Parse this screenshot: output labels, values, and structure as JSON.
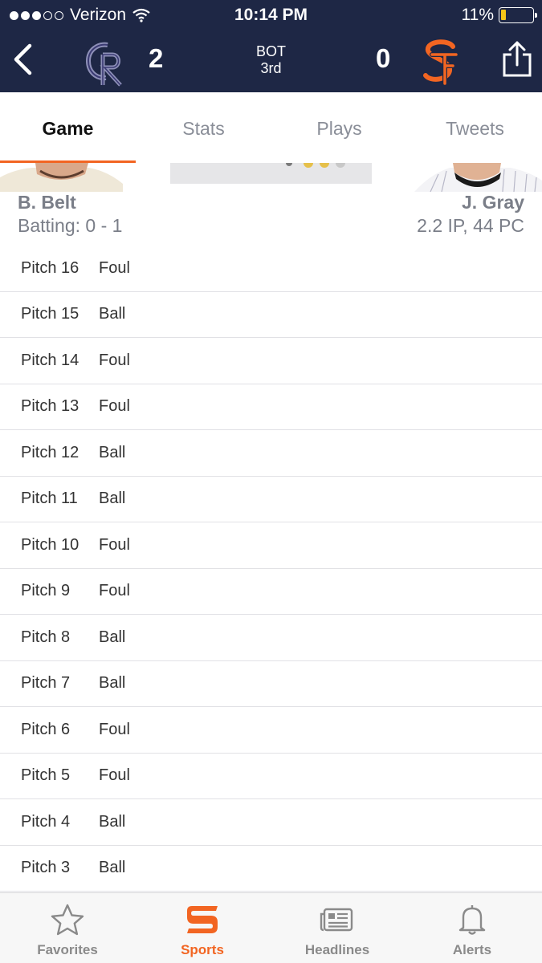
{
  "status_bar": {
    "carrier": "Verizon",
    "time": "10:14 PM",
    "battery": "11%",
    "battery_level": 0.11
  },
  "scoreboard": {
    "away_score": "2",
    "home_score": "0",
    "inning_half": "BOT",
    "inning": "3rd",
    "away_color": "#5a5a9a",
    "home_color": "#f26522"
  },
  "tabs": [
    {
      "label": "Game",
      "active": true
    },
    {
      "label": "Stats",
      "active": false
    },
    {
      "label": "Plays",
      "active": false
    },
    {
      "label": "Tweets",
      "active": false
    }
  ],
  "matchup": {
    "batter": {
      "name": "B. Belt",
      "stat": "Batting: 0 - 1"
    },
    "pitcher": {
      "name": "J. Gray",
      "stat": "2.2 IP, 44 PC"
    }
  },
  "pitches": [
    {
      "label": "Pitch 16",
      "result": "Foul"
    },
    {
      "label": "Pitch 15",
      "result": "Ball"
    },
    {
      "label": "Pitch 14",
      "result": "Foul"
    },
    {
      "label": "Pitch 13",
      "result": "Foul"
    },
    {
      "label": "Pitch 12",
      "result": "Ball"
    },
    {
      "label": "Pitch 11",
      "result": "Ball"
    },
    {
      "label": "Pitch 10",
      "result": "Foul"
    },
    {
      "label": "Pitch 9",
      "result": "Foul"
    },
    {
      "label": "Pitch 8",
      "result": "Ball"
    },
    {
      "label": "Pitch 7",
      "result": "Ball"
    },
    {
      "label": "Pitch 6",
      "result": "Foul"
    },
    {
      "label": "Pitch 5",
      "result": "Foul"
    },
    {
      "label": "Pitch 4",
      "result": "Ball"
    },
    {
      "label": "Pitch 3",
      "result": "Ball"
    }
  ],
  "bottom_nav": [
    {
      "label": "Favorites",
      "icon": "star-icon",
      "active": false
    },
    {
      "label": "Sports",
      "icon": "sports-logo-icon",
      "active": true
    },
    {
      "label": "Headlines",
      "icon": "newspaper-icon",
      "active": false
    },
    {
      "label": "Alerts",
      "icon": "bell-icon",
      "active": false
    }
  ],
  "colors": {
    "header_bg": "#1e2745",
    "accent": "#f26522"
  }
}
